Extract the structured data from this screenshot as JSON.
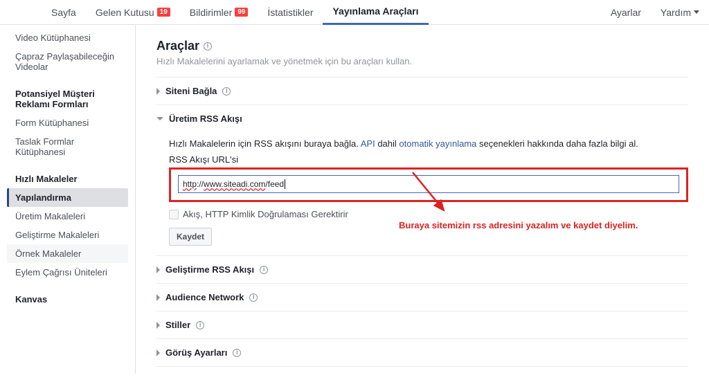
{
  "tabs": {
    "page": "Sayfa",
    "inbox": "Gelen Kutusu",
    "inbox_badge": "19",
    "notifications": "Bildirimler",
    "notifications_badge": "99",
    "stats": "İstatistikler",
    "publishing": "Yayınlama Araçları",
    "settings": "Ayarlar",
    "help": "Yardım"
  },
  "sidebar": {
    "video_library": "Video Kütüphanesi",
    "crosspost": "Çapraz Paylaşabileceğin Videolar",
    "leads_heading": "Potansiyel Müşteri Reklamı Formları",
    "form_library": "Form Kütüphanesi",
    "draft_forms": "Taslak Formlar Kütüphanesi",
    "ia_heading": "Hızlı Makaleler",
    "config": "Yapılandırma",
    "prod_articles": "Üretim Makaleleri",
    "dev_articles": "Geliştirme Makaleleri",
    "sample_articles": "Örnek Makaleler",
    "cta_units": "Eylem Çağrısı Üniteleri",
    "canvas_heading": "Kanvas"
  },
  "content": {
    "title": "Araçlar",
    "subtitle": "Hızlı Makalelerini ayarlamak ve yönetmek için bu araçları kullan.",
    "acc_connect": "Siteni Bağla",
    "acc_prod_rss": "Üretim RSS Akışı",
    "rss_desc_1": "Hızlı Makalelerin için RSS akışını buraya bağla. ",
    "rss_desc_api": "API",
    "rss_desc_2": " dahil ",
    "rss_desc_auto": "otomatik yayınlama",
    "rss_desc_3": " seçenekleri hakkında daha fazla bilgi al.",
    "rss_field_label": "RSS Akışı URL'si",
    "rss_value": "http://www.siteadi.com/feed",
    "rss_auth": "Akış, HTTP Kimlik Doğrulaması Gerektirir",
    "save": "Kaydet",
    "acc_dev_rss": "Geliştirme RSS Akışı",
    "acc_audience": "Audience Network",
    "acc_styles": "Stiller",
    "acc_view": "Görüş Ayarları"
  },
  "annotation": {
    "text": "Buraya sitemizin rss adresini yazalım ve kaydet diyelim."
  }
}
